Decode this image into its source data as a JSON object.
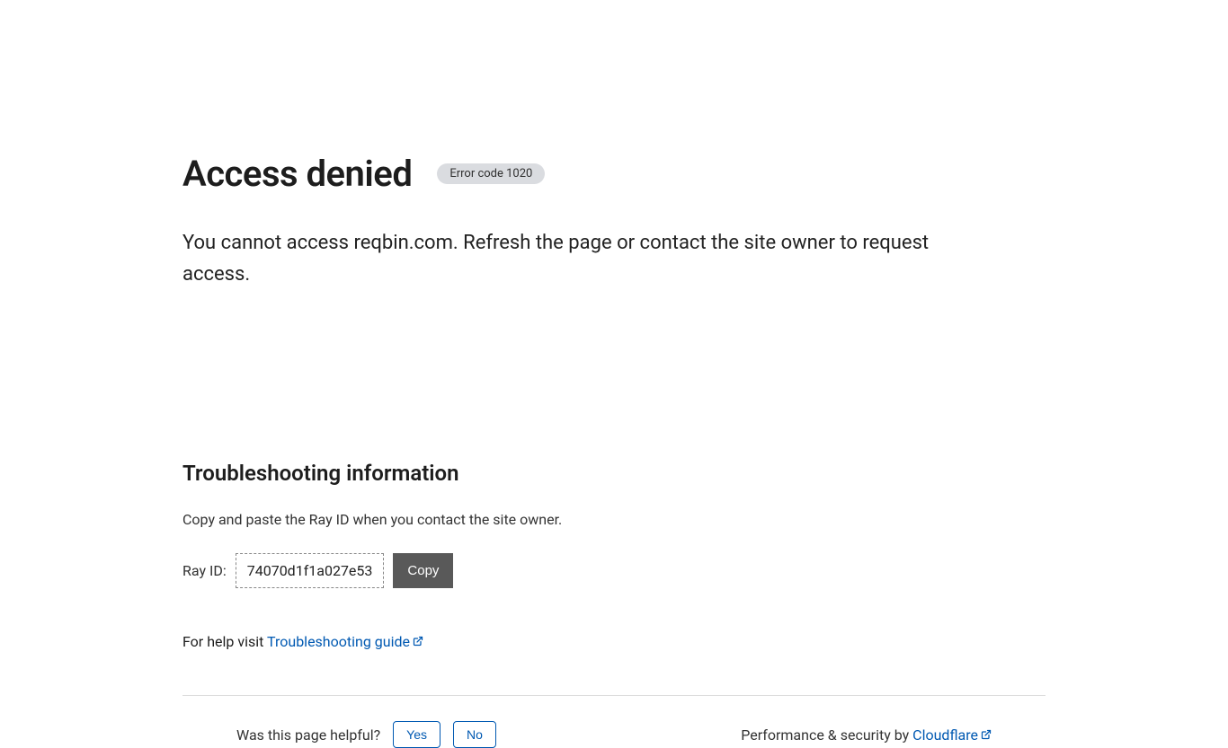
{
  "header": {
    "title": "Access denied",
    "error_badge": "Error code 1020"
  },
  "message": "You cannot access reqbin.com. Refresh the page or contact the site owner to request access.",
  "troubleshooting": {
    "subtitle": "Troubleshooting information",
    "instruction": "Copy and paste the Ray ID when you contact the site owner.",
    "ray_id_label": "Ray ID:",
    "ray_id_value": "74070d1f1a027e53",
    "copy_button": "Copy",
    "help_prefix": "For help visit ",
    "help_link": "Troubleshooting guide"
  },
  "footer": {
    "feedback_question": "Was this page helpful?",
    "yes_label": "Yes",
    "no_label": "No",
    "perf_text": "Performance & security by ",
    "cloudflare_link": "Cloudflare"
  }
}
